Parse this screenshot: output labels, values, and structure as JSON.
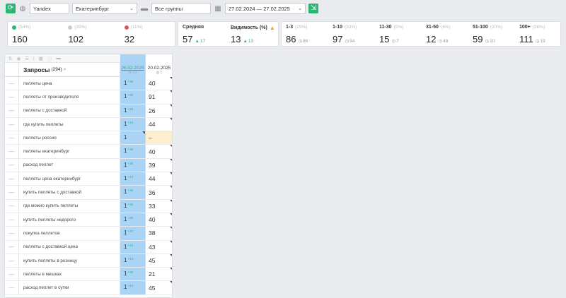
{
  "toolbar": {
    "engine": "Yandex",
    "region": "Екатеринбург",
    "group": "Все группы",
    "date_range": "27.02.2024 — 27.02.2025"
  },
  "stats": {
    "up": {
      "pct": "(54%)",
      "value": "160"
    },
    "same": {
      "pct": "(35%)",
      "value": "102"
    },
    "down": {
      "pct": "(11%)",
      "value": "32"
    },
    "avg": {
      "label": "Средняя",
      "value": "57",
      "delta": "17"
    },
    "vis": {
      "label": "Видимость (%)",
      "value": "13",
      "delta": "13"
    },
    "ranges": [
      {
        "label": "1-3",
        "pct": "(29%)",
        "value": "86",
        "delta": "86"
      },
      {
        "label": "1-10",
        "pct": "(33%)",
        "value": "97",
        "delta": "94"
      },
      {
        "label": "11-30",
        "pct": "(5%)",
        "value": "15",
        "delta": "7"
      },
      {
        "label": "31-50",
        "pct": "(4%)",
        "value": "12",
        "delta": "48"
      },
      {
        "label": "51-100",
        "pct": "(20%)",
        "value": "59",
        "delta": "20"
      },
      {
        "label": "100+",
        "pct": "(38%)",
        "value": "111",
        "delta": "19"
      }
    ]
  },
  "table": {
    "header": {
      "title": "Запросы",
      "count": "(294)",
      "date1": "26.02.2025",
      "date1_sub": "13",
      "date2": "20.02.2025",
      "date2_sub": "1"
    },
    "rows": [
      {
        "q": "пеллеты цена",
        "p1": "1",
        "d1": "+39",
        "p2": "40"
      },
      {
        "q": "пеллеты от производителя",
        "p1": "1",
        "d1": "+90",
        "p2": "91"
      },
      {
        "q": "пеллеты с доставкой",
        "p1": "1",
        "d1": "+25",
        "p2": "26"
      },
      {
        "q": "где купить пеллеты",
        "p1": "1",
        "d1": "+43",
        "p2": "44"
      },
      {
        "q": "пеллеты россия",
        "p1": "1",
        "d1": "",
        "p2": "–"
      },
      {
        "q": "пеллеты екатеринбург",
        "p1": "1",
        "d1": "+39",
        "p2": "40"
      },
      {
        "q": "расход пеллет",
        "p1": "1",
        "d1": "+38",
        "p2": "39"
      },
      {
        "q": "пеллеты цена екатеринбург",
        "p1": "1",
        "d1": "+43",
        "p2": "44"
      },
      {
        "q": "купить пеллеты с доставкой",
        "p1": "1",
        "d1": "+35",
        "p2": "36"
      },
      {
        "q": "где можно купить пеллеты",
        "p1": "1",
        "d1": "+32",
        "p2": "33"
      },
      {
        "q": "купить пеллеты недорого",
        "p1": "1",
        "d1": "+39",
        "p2": "40"
      },
      {
        "q": "покупка пеллетов",
        "p1": "1",
        "d1": "+37",
        "p2": "38"
      },
      {
        "q": "пеллеты с доставкой цена",
        "p1": "1",
        "d1": "+42",
        "p2": "43"
      },
      {
        "q": "купить пеллеты в розницу",
        "p1": "1",
        "d1": "+44",
        "p2": "45"
      },
      {
        "q": "пеллеты в мешках",
        "p1": "1",
        "d1": "+20",
        "p2": "21"
      },
      {
        "q": "расход пеллет в сутки",
        "p1": "1",
        "d1": "+44",
        "p2": "45"
      }
    ]
  }
}
